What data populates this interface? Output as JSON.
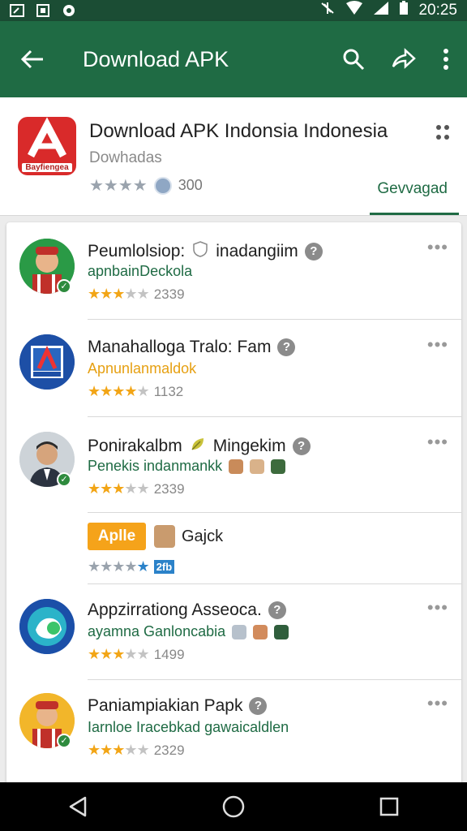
{
  "status_bar": {
    "time": "20:25"
  },
  "app_bar": {
    "title": "Download APK"
  },
  "header": {
    "title": "Download APK Indonsia Indonesia",
    "subtitle": "Dowhadas",
    "rating_count": "300",
    "install_label": "Gevvagad",
    "icon_caption": "Bayfiengea"
  },
  "list": [
    {
      "title": "Peumlolsiop:",
      "title_extra": "inadangiim",
      "subtitle": "apnbainDeckola",
      "rating_count": "2339"
    },
    {
      "title": "Manahalloga Tralo: Fam",
      "subtitle": "Apnunlanmaldok",
      "rating_count": "1132"
    },
    {
      "title": "Ponirakalbm",
      "title_extra": "Mingekim",
      "subtitle": "Penekis indanmankk",
      "rating_count": "2339"
    },
    {
      "title": "Appzirrationg Asseoca.",
      "subtitle": "ayamna Ganloncabia",
      "rating_count": "1499"
    },
    {
      "title": "Paniampiakian Papk",
      "subtitle": "Iarnloe Iracebkad gawaicaldlen",
      "rating_count": "2329"
    }
  ],
  "sub_action": {
    "button_label": "Aplle",
    "name": "Gajck",
    "tag": "2fb"
  },
  "colors": {
    "primary": "#1f6b44",
    "status": "#1b4d34",
    "star": "#f2a516",
    "accent_orange": "#f5a31a"
  }
}
